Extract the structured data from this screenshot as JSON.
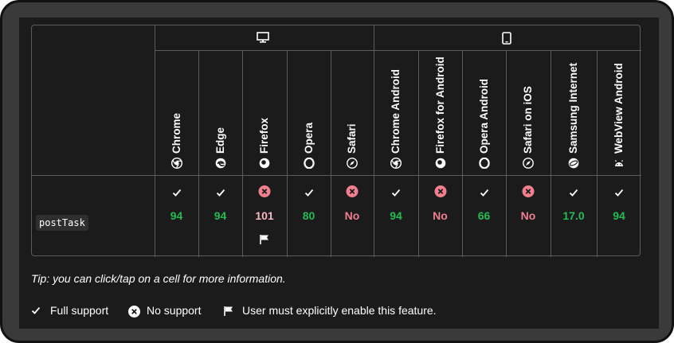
{
  "feature": {
    "name": "postTask"
  },
  "platforms": {
    "desktop_icon": "desktop-icon",
    "mobile_icon": "mobile-icon"
  },
  "browsers": [
    {
      "name": "Chrome",
      "icon": "chrome-icon",
      "support": "yes",
      "version": "94"
    },
    {
      "name": "Edge",
      "icon": "edge-icon",
      "support": "yes",
      "version": "94"
    },
    {
      "name": "Firefox",
      "icon": "firefox-icon",
      "support": "flag",
      "version": "101"
    },
    {
      "name": "Opera",
      "icon": "opera-icon",
      "support": "yes",
      "version": "80"
    },
    {
      "name": "Safari",
      "icon": "safari-icon",
      "support": "no",
      "version": "No"
    },
    {
      "name": "Chrome Android",
      "icon": "chrome-icon",
      "support": "yes",
      "version": "94"
    },
    {
      "name": "Firefox for Android",
      "icon": "firefox-icon",
      "support": "no",
      "version": "No"
    },
    {
      "name": "Opera Android",
      "icon": "opera-icon",
      "support": "yes",
      "version": "66"
    },
    {
      "name": "Safari on iOS",
      "icon": "safari-icon",
      "support": "no",
      "version": "No"
    },
    {
      "name": "Samsung Internet",
      "icon": "samsung-internet-icon",
      "support": "yes",
      "version": "17.0"
    },
    {
      "name": "WebView Android",
      "icon": "android-icon",
      "support": "yes",
      "version": "94"
    }
  ],
  "tip": "Tip: you can click/tap on a cell for more information.",
  "legend": {
    "full_support": "Full support",
    "no_support": "No support",
    "flag": "User must explicitly enable this feature."
  },
  "colors": {
    "supported": "#25bb54",
    "unsupported": "#f07f90",
    "flag_version": "#f6b9c3",
    "background": "#1b1b1b",
    "border": "#5c5c5c"
  }
}
